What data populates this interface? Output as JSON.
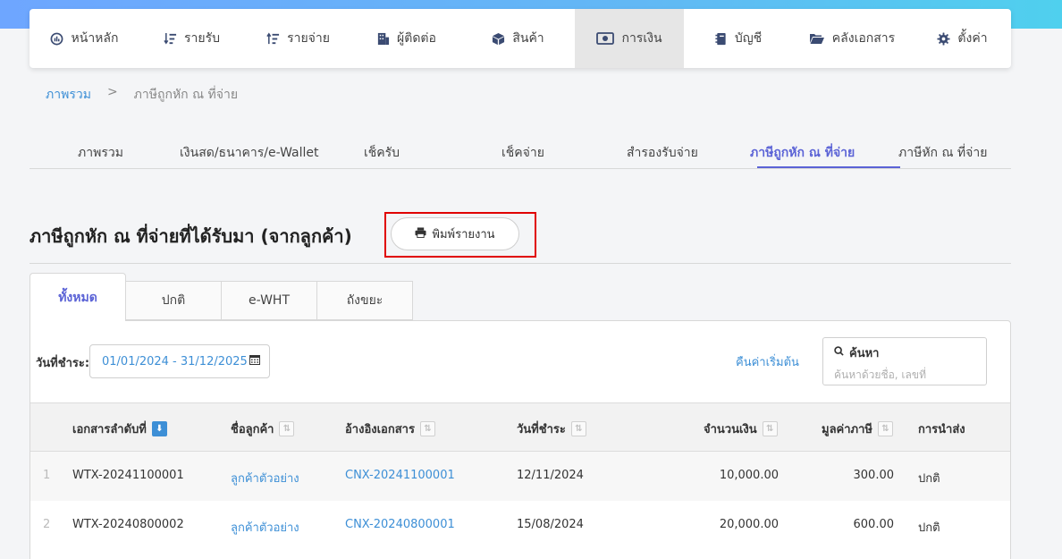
{
  "nav": {
    "items": [
      {
        "label": "หน้าหลัก"
      },
      {
        "label": "รายรับ"
      },
      {
        "label": "รายจ่าย"
      },
      {
        "label": "ผู้ติดต่อ"
      },
      {
        "label": "สินค้า"
      },
      {
        "label": "การเงิน"
      },
      {
        "label": "บัญชี"
      },
      {
        "label": "คลังเอกสาร"
      },
      {
        "label": "ตั้งค่า"
      }
    ],
    "active": "การเงิน"
  },
  "breadcrumb": {
    "root": "ภาพรวม",
    "separator": ">",
    "current": "ภาษีถูกหัก ณ ที่จ่าย"
  },
  "subtabs": [
    {
      "label": "ภาพรวม"
    },
    {
      "label": "เงินสด/ธนาคาร/e-Wallet"
    },
    {
      "label": "เช็ครับ"
    },
    {
      "label": "เช็คจ่าย"
    },
    {
      "label": "สำรองรับจ่าย"
    },
    {
      "label": "ภาษีถูกหัก ณ ที่จ่าย"
    },
    {
      "label": "ภาษีหัก ณ ที่จ่าย"
    }
  ],
  "page": {
    "title": "ภาษีถูกหัก ณ ที่จ่ายที่ได้รับมา (จากลูกค้า)",
    "print_label": "พิมพ์รายงาน"
  },
  "tabs": [
    {
      "label": "ทั้งหมด"
    },
    {
      "label": "ปกติ"
    },
    {
      "label": "e-WHT"
    },
    {
      "label": "ถังขยะ"
    }
  ],
  "filters": {
    "date_label": "วันที่ชำระ:",
    "date_range": "01/01/2024 - 31/12/2025",
    "reset_label": "คืนค่าเริ่มต้น",
    "search_title": "ค้นหา",
    "search_placeholder": "ค้นหาด้วยชื่อ, เลขที่"
  },
  "table": {
    "headers": {
      "doc_no": "เอกสารลำดับที่",
      "customer": "ชื่อลูกค้า",
      "ref_doc": "อ้างอิงเอกสาร",
      "pay_date": "วันที่ชำระ",
      "amount": "จำนวนเงิน",
      "tax": "มูลค่าภาษี",
      "submission": "การนำส่ง"
    },
    "rows": [
      {
        "idx": "1",
        "doc_no": "WTX-20241100001",
        "customer": "ลูกค้าตัวอย่าง",
        "ref_doc": "CNX-20241100001",
        "pay_date": "12/11/2024",
        "amount": "10,000.00",
        "tax": "300.00",
        "submission": "ปกติ"
      },
      {
        "idx": "2",
        "doc_no": "WTX-20240800002",
        "customer": "ลูกค้าตัวอย่าง",
        "ref_doc": "CNX-20240800001",
        "pay_date": "15/08/2024",
        "amount": "20,000.00",
        "tax": "600.00",
        "submission": "ปกติ"
      }
    ]
  },
  "colors": {
    "accent": "#5b63d6",
    "link": "#3d8fd6",
    "highlight_border": "#e00000"
  }
}
